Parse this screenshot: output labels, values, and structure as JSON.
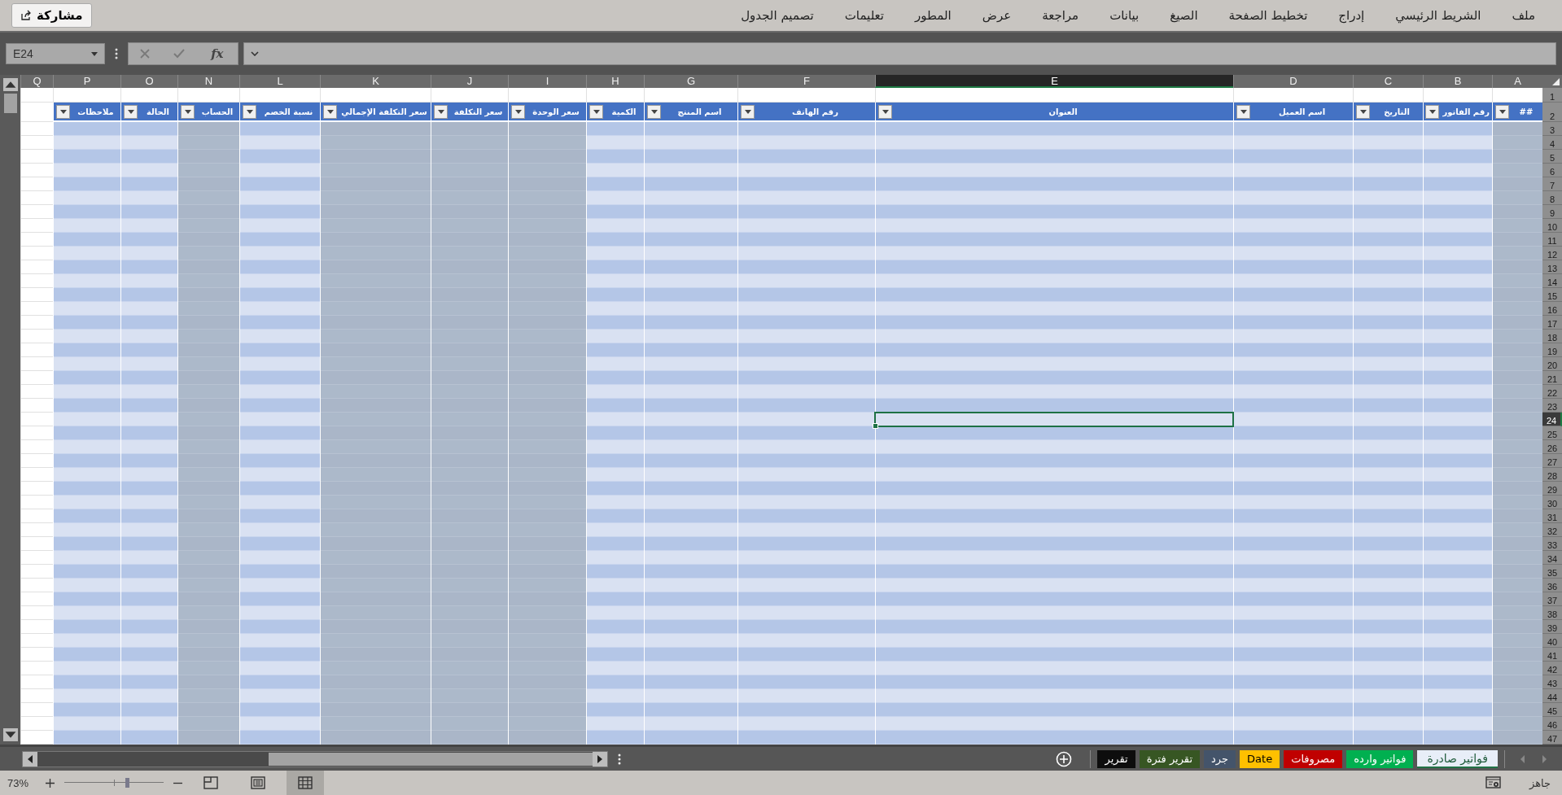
{
  "ribbon": {
    "share_button": "مشاركة",
    "tabs": [
      {
        "label": "ملف",
        "selected": false
      },
      {
        "label": "الشريط الرئيسي",
        "selected": false
      },
      {
        "label": "إدراج",
        "selected": false
      },
      {
        "label": "تخطيط الصفحة",
        "selected": false
      },
      {
        "label": "الصيغ",
        "selected": false
      },
      {
        "label": "بيانات",
        "selected": false
      },
      {
        "label": "مراجعة",
        "selected": false
      },
      {
        "label": "عرض",
        "selected": false
      },
      {
        "label": "المطور",
        "selected": false
      },
      {
        "label": "تعليمات",
        "selected": false
      },
      {
        "label": "تصميم الجدول",
        "selected": false
      }
    ]
  },
  "formula_bar": {
    "name_box": "E24",
    "function_label": "fx"
  },
  "sheet": {
    "columns": [
      {
        "letter": "A",
        "header": "##",
        "shaded": true,
        "selected": false
      },
      {
        "letter": "B",
        "header": "رقم الفاتور",
        "shaded": false,
        "selected": false
      },
      {
        "letter": "C",
        "header": "التاريخ",
        "shaded": false,
        "selected": false
      },
      {
        "letter": "D",
        "header": "اسم العميل",
        "shaded": false,
        "selected": false
      },
      {
        "letter": "E",
        "header": "العنوان",
        "shaded": false,
        "selected": true
      },
      {
        "letter": "F",
        "header": "رقم الهاتف",
        "shaded": false,
        "selected": false
      },
      {
        "letter": "G",
        "header": "اسم المنتج",
        "shaded": false,
        "selected": false
      },
      {
        "letter": "H",
        "header": "الكمية",
        "shaded": false,
        "selected": false
      },
      {
        "letter": "I",
        "header": "سعر الوحدة",
        "shaded": true,
        "selected": false
      },
      {
        "letter": "J",
        "header": "سعر التكلفة",
        "shaded": true,
        "selected": false
      },
      {
        "letter": "K",
        "header": "سعر التكلفة الإجمالي",
        "shaded": true,
        "selected": false
      },
      {
        "letter": "L",
        "header": "نسبة الخصم",
        "shaded": false,
        "selected": false
      },
      {
        "letter": "N",
        "header": "الحساب",
        "shaded": true,
        "selected": false
      },
      {
        "letter": "O",
        "header": "الحالة",
        "shaded": false,
        "selected": false
      },
      {
        "letter": "P",
        "header": "ملاحظات",
        "shaded": false,
        "selected": false
      },
      {
        "letter": "Q",
        "selected": false
      }
    ],
    "rows": [
      {
        "label": "1",
        "selected": false
      },
      {
        "label": "2",
        "selected": false
      },
      {
        "label": "3",
        "selected": false
      },
      {
        "label": "4",
        "selected": false
      },
      {
        "label": "5",
        "selected": false
      },
      {
        "label": "6",
        "selected": false
      },
      {
        "label": "7",
        "selected": false
      },
      {
        "label": "8",
        "selected": false
      },
      {
        "label": "9",
        "selected": false
      },
      {
        "label": "10",
        "selected": false
      },
      {
        "label": "11",
        "selected": false
      },
      {
        "label": "12",
        "selected": false
      },
      {
        "label": "13",
        "selected": false
      },
      {
        "label": "14",
        "selected": false
      },
      {
        "label": "15",
        "selected": false
      },
      {
        "label": "16",
        "selected": false
      },
      {
        "label": "17",
        "selected": false
      },
      {
        "label": "18",
        "selected": false
      },
      {
        "label": "19",
        "selected": false
      },
      {
        "label": "20",
        "selected": false
      },
      {
        "label": "21",
        "selected": false
      },
      {
        "label": "22",
        "selected": false
      },
      {
        "label": "23",
        "selected": false
      },
      {
        "label": "24",
        "selected": true
      },
      {
        "label": "25",
        "selected": false
      },
      {
        "label": "26",
        "selected": false
      },
      {
        "label": "27",
        "selected": false
      },
      {
        "label": "28",
        "selected": false
      },
      {
        "label": "29",
        "selected": false
      },
      {
        "label": "30",
        "selected": false
      },
      {
        "label": "31",
        "selected": false
      },
      {
        "label": "32",
        "selected": false
      },
      {
        "label": "33",
        "selected": false
      },
      {
        "label": "34",
        "selected": false
      },
      {
        "label": "35",
        "selected": false
      },
      {
        "label": "36",
        "selected": false
      },
      {
        "label": "37",
        "selected": false
      },
      {
        "label": "38",
        "selected": false
      },
      {
        "label": "39",
        "selected": false
      },
      {
        "label": "40",
        "selected": false
      },
      {
        "label": "41",
        "selected": false
      },
      {
        "label": "42",
        "selected": false
      },
      {
        "label": "43",
        "selected": false
      },
      {
        "label": "44",
        "selected": false
      },
      {
        "label": "45",
        "selected": false
      },
      {
        "label": "46",
        "selected": false
      },
      {
        "label": "47",
        "selected": false
      }
    ]
  },
  "sheet_tabs": [
    {
      "label": "فواتير صادرة",
      "selected": true,
      "color": "#e8eef8"
    },
    {
      "label": "فواتير وارده",
      "selected": false,
      "color": "#00b050"
    },
    {
      "label": "مصروفات",
      "selected": false,
      "color": "#c00000"
    },
    {
      "label": "Date",
      "selected": false,
      "color": "#ffc000"
    },
    {
      "label": "جرد",
      "selected": false,
      "color": "#44546a"
    },
    {
      "label": "تقرير فترة",
      "selected": false,
      "color": "#375623"
    },
    {
      "label": "تقرير",
      "selected": false,
      "color": "#0d0d0d"
    }
  ],
  "status_bar": {
    "status": "جاهز",
    "zoom": "73%",
    "zoom_level": {
      "level": 0.64
    },
    "views": [
      {
        "kind": "page_break",
        "selected": false
      },
      {
        "kind": "page_layout",
        "selected": false
      },
      {
        "kind": "normal",
        "selected": true
      }
    ]
  }
}
